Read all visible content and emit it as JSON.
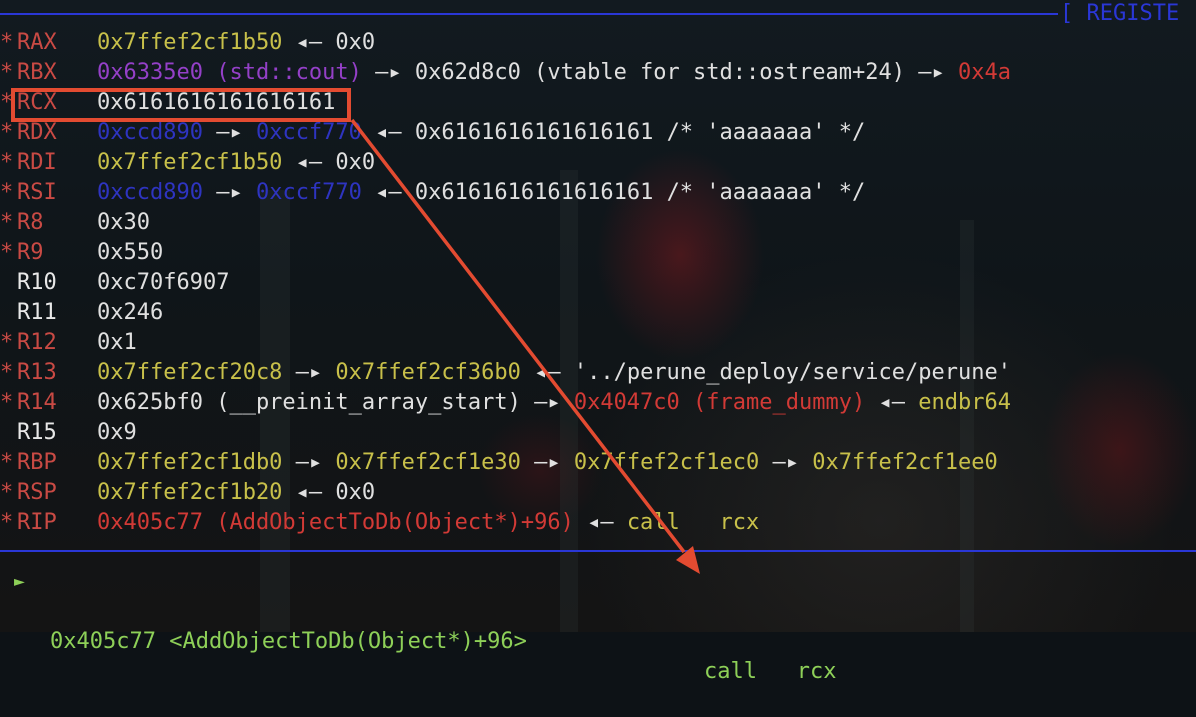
{
  "header": {
    "title": "[ REGISTE"
  },
  "registers": [
    {
      "name": "RAX",
      "changed": true,
      "parts": [
        {
          "t": "0x7ffef2cf1b50",
          "c": "c-yellow"
        },
        {
          "t": " ◂— ",
          "c": "c-white"
        },
        {
          "t": "0x0",
          "c": "c-white"
        }
      ]
    },
    {
      "name": "RBX",
      "changed": true,
      "parts": [
        {
          "t": "0x6335e0 (std::cout)",
          "c": "c-purple"
        },
        {
          "t": " —▸ ",
          "c": "c-white"
        },
        {
          "t": "0x62d8c0 (vtable for std::ostream+24)",
          "c": "c-white"
        },
        {
          "t": " —▸ ",
          "c": "c-white"
        },
        {
          "t": "0x4a",
          "c": "c-red"
        }
      ]
    },
    {
      "name": "RCX",
      "changed": true,
      "parts": [
        {
          "t": "0x6161616161616161",
          "c": "c-white"
        }
      ]
    },
    {
      "name": "RDX",
      "changed": true,
      "parts": [
        {
          "t": "0xccd890",
          "c": "c-blue"
        },
        {
          "t": " —▸ ",
          "c": "c-white"
        },
        {
          "t": "0xccf770",
          "c": "c-blue"
        },
        {
          "t": " ◂— ",
          "c": "c-white"
        },
        {
          "t": "0x6161616161616161 /* 'aaaaaaa' */",
          "c": "c-white"
        }
      ]
    },
    {
      "name": "RDI",
      "changed": true,
      "parts": [
        {
          "t": "0x7ffef2cf1b50",
          "c": "c-yellow"
        },
        {
          "t": " ◂— ",
          "c": "c-white"
        },
        {
          "t": "0x0",
          "c": "c-white"
        }
      ]
    },
    {
      "name": "RSI",
      "changed": true,
      "parts": [
        {
          "t": "0xccd890",
          "c": "c-blue"
        },
        {
          "t": " —▸ ",
          "c": "c-white"
        },
        {
          "t": "0xccf770",
          "c": "c-blue"
        },
        {
          "t": " ◂— ",
          "c": "c-white"
        },
        {
          "t": "0x6161616161616161 /* 'aaaaaaa' */",
          "c": "c-white"
        }
      ]
    },
    {
      "name": "R8",
      "changed": true,
      "parts": [
        {
          "t": "0x30",
          "c": "c-white"
        }
      ]
    },
    {
      "name": "R9",
      "changed": true,
      "parts": [
        {
          "t": "0x550",
          "c": "c-white"
        }
      ]
    },
    {
      "name": "R10",
      "changed": false,
      "parts": [
        {
          "t": "0xc70f6907",
          "c": "c-white"
        }
      ]
    },
    {
      "name": "R11",
      "changed": false,
      "parts": [
        {
          "t": "0x246",
          "c": "c-white"
        }
      ]
    },
    {
      "name": "R12",
      "changed": true,
      "parts": [
        {
          "t": "0x1",
          "c": "c-white"
        }
      ]
    },
    {
      "name": "R13",
      "changed": true,
      "parts": [
        {
          "t": "0x7ffef2cf20c8",
          "c": "c-yellow"
        },
        {
          "t": " —▸ ",
          "c": "c-white"
        },
        {
          "t": "0x7ffef2cf36b0",
          "c": "c-yellow"
        },
        {
          "t": " ◂— ",
          "c": "c-white"
        },
        {
          "t": "'../perune_deploy/service/perune'",
          "c": "c-white"
        }
      ]
    },
    {
      "name": "R14",
      "changed": true,
      "parts": [
        {
          "t": "0x625bf0 (__preinit_array_start)",
          "c": "c-white"
        },
        {
          "t": " —▸ ",
          "c": "c-white"
        },
        {
          "t": "0x4047c0 (frame_dummy)",
          "c": "c-red"
        },
        {
          "t": " ◂— ",
          "c": "c-white"
        },
        {
          "t": "endbr64",
          "c": "c-yellow"
        }
      ]
    },
    {
      "name": "R15",
      "changed": false,
      "parts": [
        {
          "t": "0x9",
          "c": "c-white"
        }
      ]
    },
    {
      "name": "RBP",
      "changed": true,
      "parts": [
        {
          "t": "0x7ffef2cf1db0",
          "c": "c-yellow"
        },
        {
          "t": " —▸ ",
          "c": "c-white"
        },
        {
          "t": "0x7ffef2cf1e30",
          "c": "c-yellow"
        },
        {
          "t": " —▸ ",
          "c": "c-white"
        },
        {
          "t": "0x7ffef2cf1ec0",
          "c": "c-yellow"
        },
        {
          "t": " —▸ ",
          "c": "c-white"
        },
        {
          "t": "0x7ffef2cf1ee0",
          "c": "c-yellow"
        }
      ]
    },
    {
      "name": "RSP",
      "changed": true,
      "parts": [
        {
          "t": "0x7ffef2cf1b20",
          "c": "c-yellow"
        },
        {
          "t": " ◂— ",
          "c": "c-white"
        },
        {
          "t": "0x0",
          "c": "c-white"
        }
      ]
    },
    {
      "name": "RIP",
      "changed": true,
      "parts": [
        {
          "t": "0x405c77 (AddObjectToDb(Object*)+96)",
          "c": "c-red"
        },
        {
          "t": " ◂— ",
          "c": "c-white"
        },
        {
          "t": "call   rcx",
          "c": "c-yellow"
        }
      ]
    }
  ],
  "disasm": {
    "marker": "►",
    "address": "0x405c77 <AddObjectToDb(Object*)+96>",
    "instruction": "call   rcx"
  },
  "colors": {
    "divider": "#2a37d6",
    "highlight": "#e34b31",
    "changed_marker": "#c94a44"
  },
  "annotation": {
    "icon": "arrow-down-right-icon"
  }
}
